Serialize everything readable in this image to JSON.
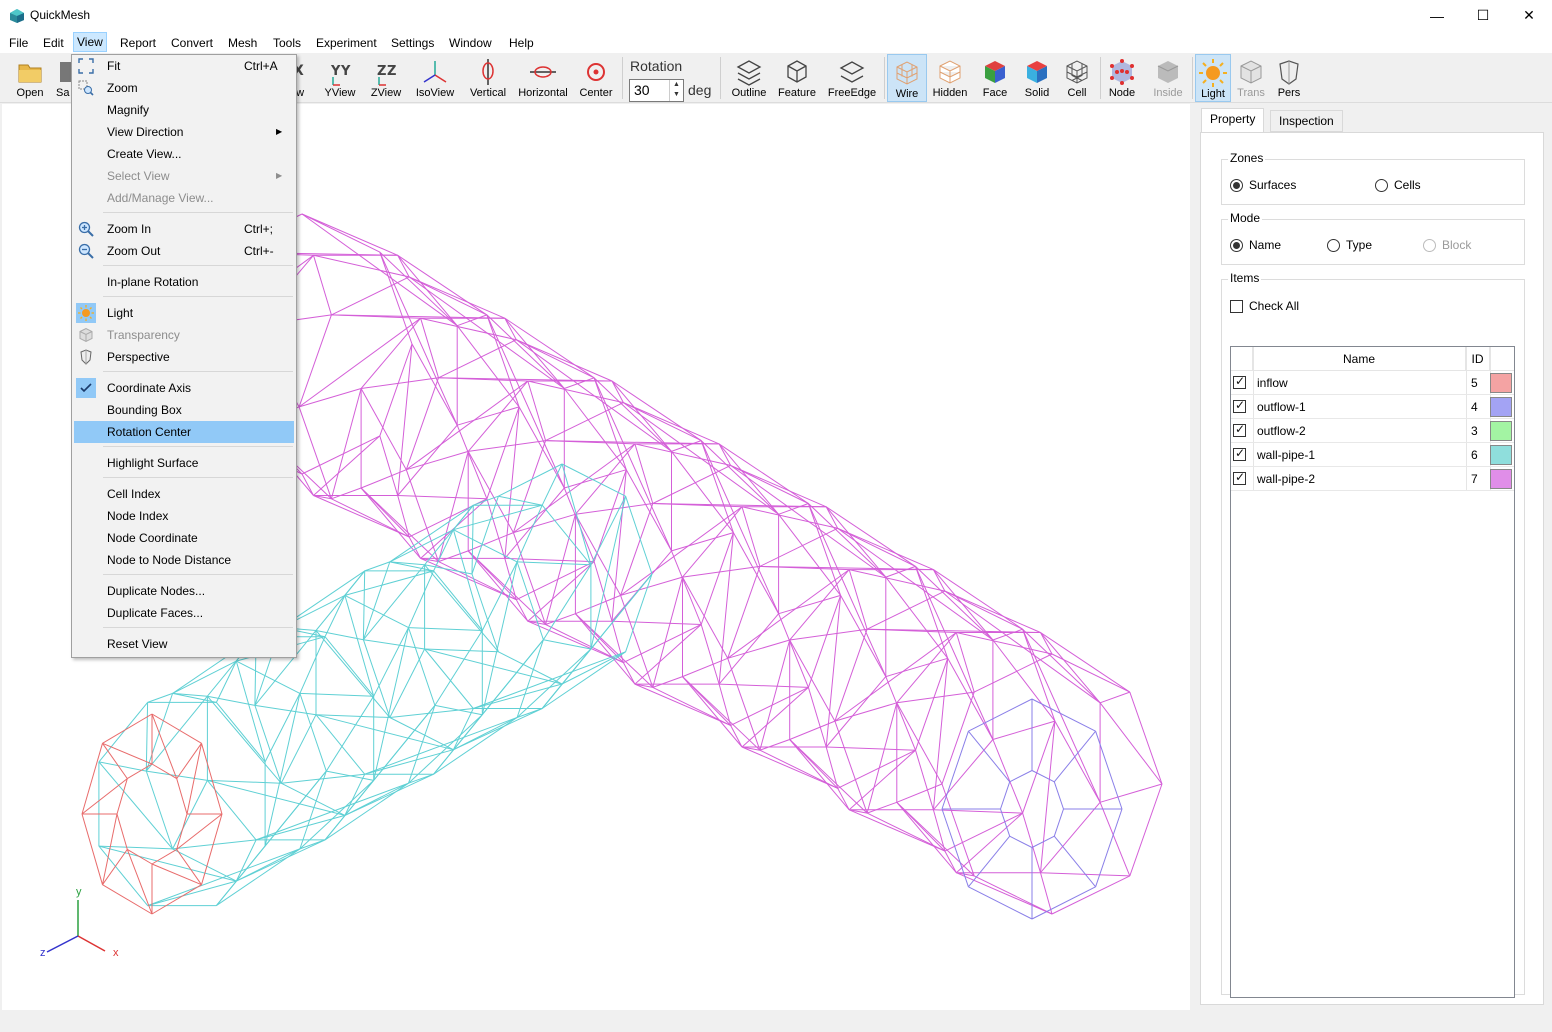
{
  "window": {
    "title": "QuickMesh",
    "minimize": "—",
    "maximize": "☐",
    "close": "✕"
  },
  "menubar": [
    "File",
    "Edit",
    "View",
    "Report",
    "Convert",
    "Mesh",
    "Tools",
    "Experiment",
    "Settings",
    "Window",
    "Help"
  ],
  "toolbar": {
    "buttons": [
      {
        "label": "Open",
        "icon": "folder-icon"
      },
      {
        "label": "Sa",
        "icon": "save-icon"
      },
      {
        "label": "ew",
        "icon": "xview-icon"
      },
      {
        "label": "YView",
        "icon": "yview-icon"
      },
      {
        "label": "ZView",
        "icon": "zview-icon"
      },
      {
        "label": "IsoView",
        "icon": "isoview-icon"
      },
      {
        "label": "Vertical",
        "icon": "vertical-rotation-icon"
      },
      {
        "label": "Horizontal",
        "icon": "horizontal-rotation-icon"
      },
      {
        "label": "Center",
        "icon": "center-icon"
      },
      {
        "label": "Outline",
        "icon": "outline-icon"
      },
      {
        "label": "Feature",
        "icon": "feature-icon"
      },
      {
        "label": "FreeEdge",
        "icon": "free-edge-icon"
      },
      {
        "label": "Wire",
        "icon": "wire-icon"
      },
      {
        "label": "Hidden",
        "icon": "hidden-icon"
      },
      {
        "label": "Face",
        "icon": "face-icon"
      },
      {
        "label": "Solid",
        "icon": "solid-icon"
      },
      {
        "label": "Cell",
        "icon": "cell-icon"
      },
      {
        "label": "Node",
        "icon": "node-icon"
      },
      {
        "label": "Inside",
        "icon": "inside-icon"
      },
      {
        "label": "Light",
        "icon": "light-icon"
      },
      {
        "label": "Trans",
        "icon": "transparency-icon"
      },
      {
        "label": "Pers",
        "icon": "perspective-icon"
      }
    ],
    "rotation_label": "Rotation",
    "rotation_value": "30",
    "rotation_unit": "deg"
  },
  "view_menu": {
    "items": [
      {
        "label": "Fit",
        "shortcut": "Ctrl+A",
        "icon": "fit-icon"
      },
      {
        "label": "Zoom",
        "icon": "zoom-icon"
      },
      {
        "label": "Magnify"
      },
      {
        "label": "View Direction",
        "submenu": true
      },
      {
        "label": "Create View..."
      },
      {
        "label": "Select View",
        "submenu": true,
        "disabled": true
      },
      {
        "label": "Add/Manage View...",
        "disabled": true
      },
      {
        "label": "Zoom In",
        "shortcut": "Ctrl+;",
        "icon": "zoom-in-icon"
      },
      {
        "label": "Zoom Out",
        "shortcut": "Ctrl+-",
        "icon": "zoom-out-icon"
      },
      {
        "label": "In-plane Rotation"
      },
      {
        "label": "Light",
        "icon": "light-icon",
        "checked": true
      },
      {
        "label": "Transparency",
        "icon": "transparency-icon",
        "disabled": true
      },
      {
        "label": "Perspective",
        "icon": "perspective-icon"
      },
      {
        "label": "Coordinate Axis",
        "icon": "checkmark-icon",
        "checked": true
      },
      {
        "label": "Bounding Box"
      },
      {
        "label": "Rotation Center",
        "highlighted": true
      },
      {
        "label": "Highlight Surface"
      },
      {
        "label": "Cell Index"
      },
      {
        "label": "Node Index"
      },
      {
        "label": "Node Coordinate"
      },
      {
        "label": "Node to Node Distance"
      },
      {
        "label": "Duplicate Nodes..."
      },
      {
        "label": "Duplicate Faces..."
      },
      {
        "label": "Reset View"
      }
    ]
  },
  "panel": {
    "tabs": [
      "Property",
      "Inspection"
    ],
    "active_tab": "Property",
    "zones": {
      "title": "Zones",
      "options": [
        "Surfaces",
        "Cells"
      ],
      "selected": "Surfaces"
    },
    "mode": {
      "title": "Mode",
      "options": [
        "Name",
        "Type",
        "Block"
      ],
      "selected": "Name",
      "disabled": [
        "Block"
      ]
    },
    "items": {
      "title": "Items",
      "check_all": "Check All",
      "columns": [
        "Name",
        "ID"
      ],
      "rows": [
        {
          "name": "inflow",
          "id": "5",
          "color": "#f4a3a3",
          "checked": true
        },
        {
          "name": "outflow-1",
          "id": "4",
          "color": "#a3a3f4",
          "checked": true
        },
        {
          "name": "outflow-2",
          "id": "3",
          "color": "#a3f4a3",
          "checked": true
        },
        {
          "name": "wall-pipe-1",
          "id": "6",
          "color": "#8fdedc",
          "checked": true
        },
        {
          "name": "wall-pipe-2",
          "id": "7",
          "color": "#e08ee8",
          "checked": true
        }
      ]
    }
  },
  "axis_triad": {
    "x": "x",
    "y": "y",
    "z": "z"
  },
  "colors": {
    "inflow_wire": "#e86b6b",
    "wall_pipe_1_wire": "#5fd0d4",
    "wall_pipe_2_wire": "#d45fd8",
    "outflow_1_wire": "#8a7fe8",
    "menu_highlight": "#91c9f7"
  }
}
